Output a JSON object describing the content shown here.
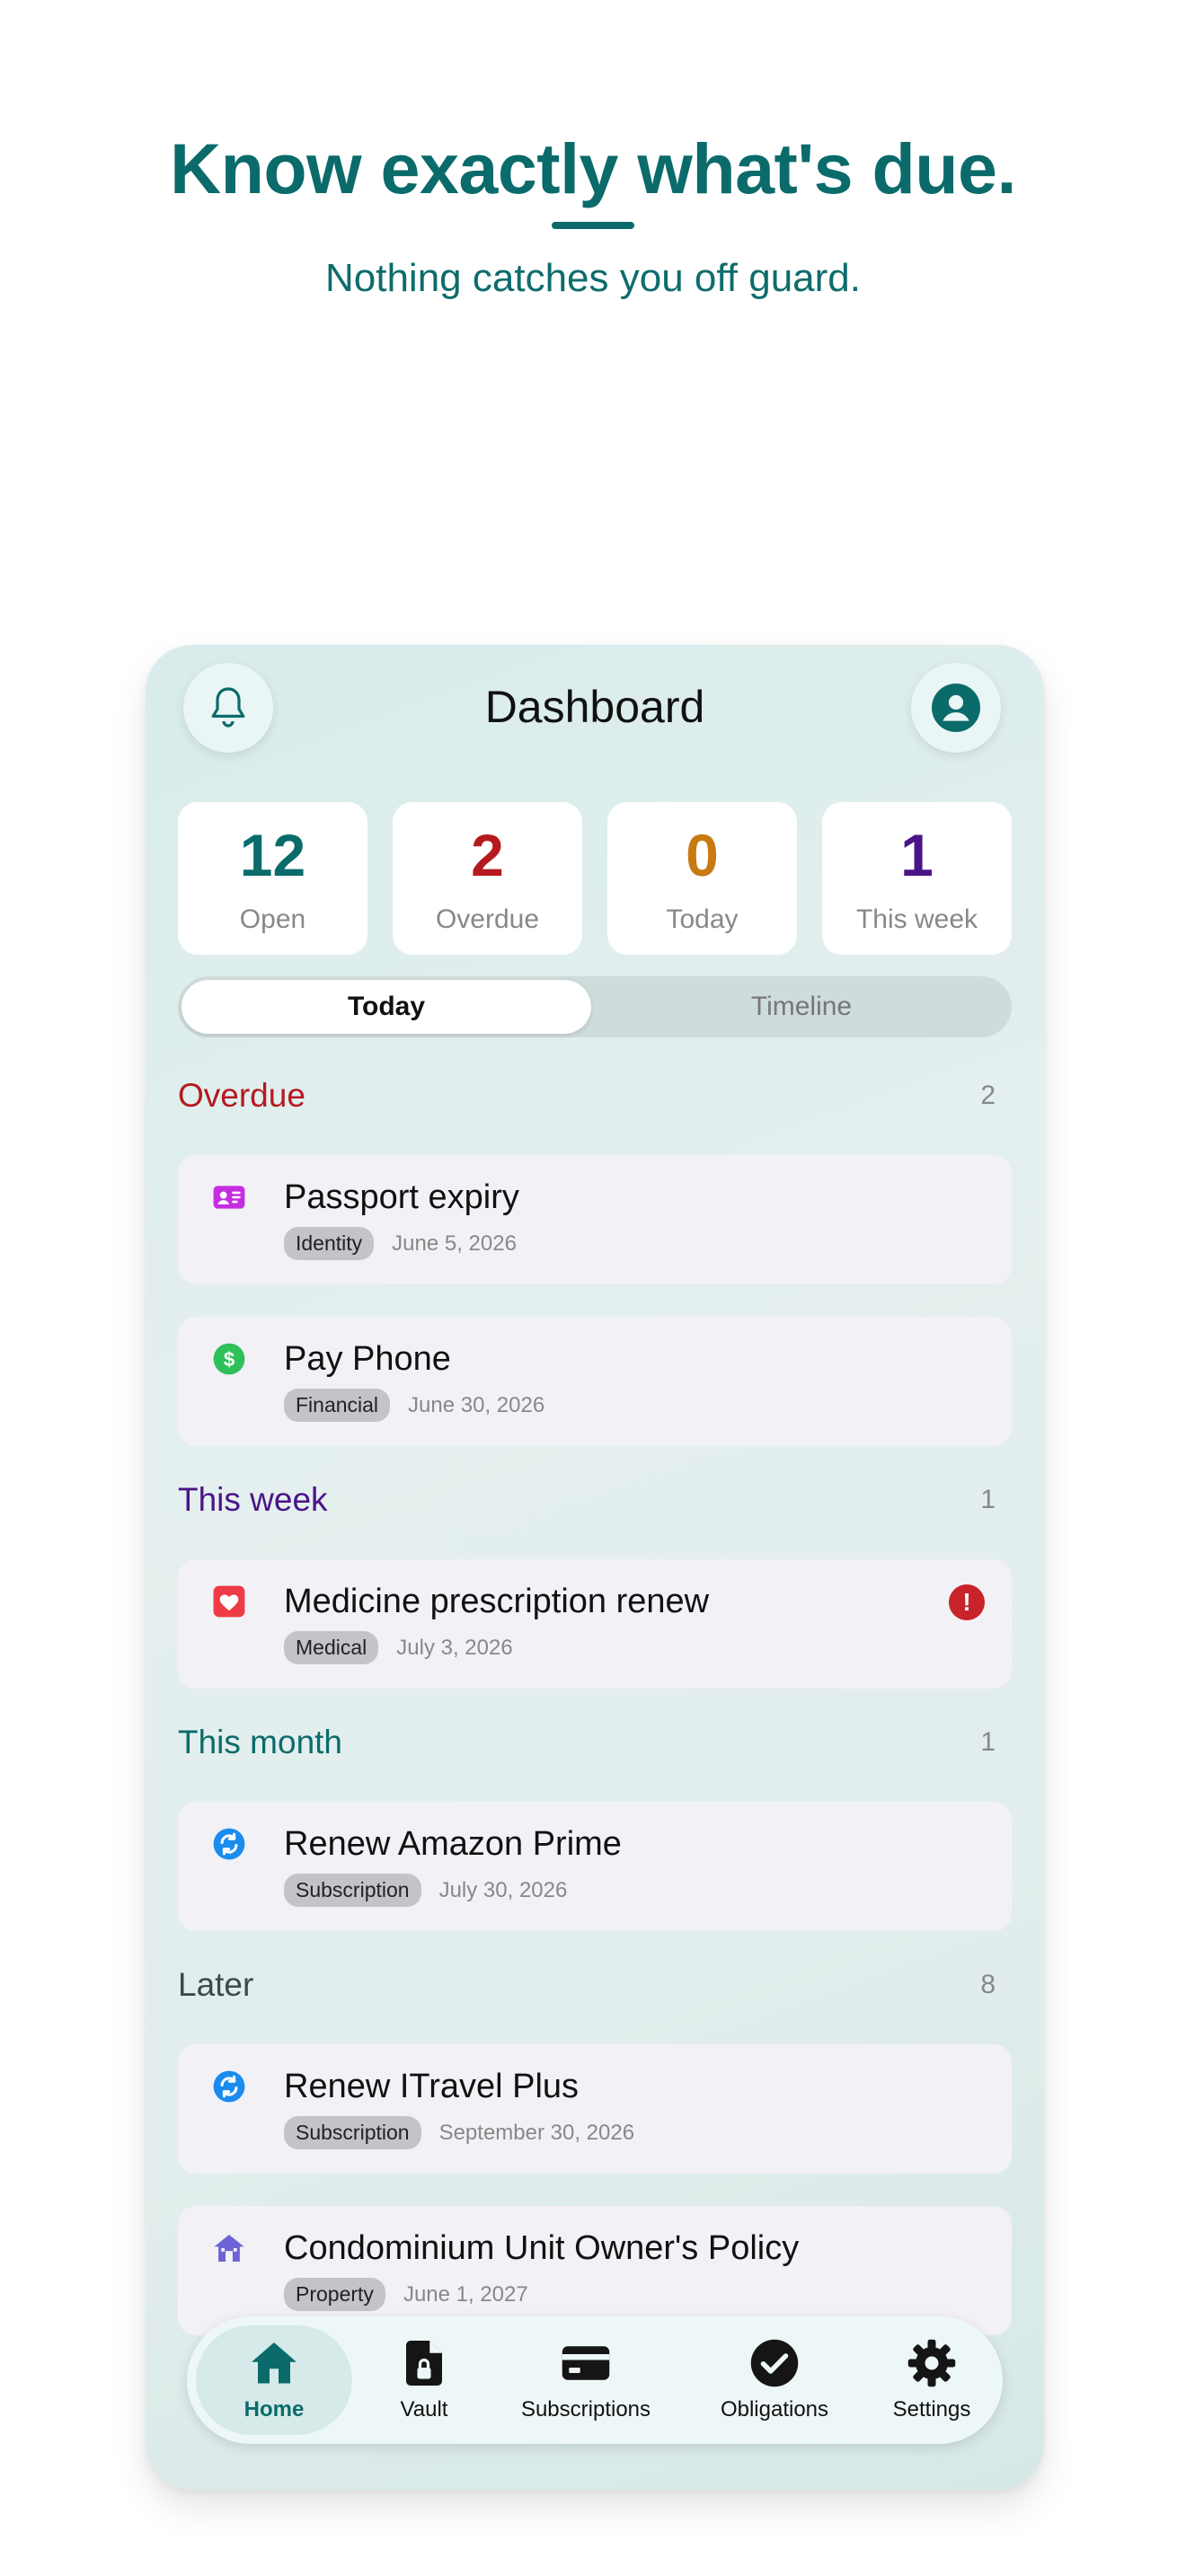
{
  "hero": {
    "title": "Know exactly what's due.",
    "subtitle": "Nothing catches you off guard."
  },
  "header": {
    "title": "Dashboard",
    "left_icon": "bell-icon",
    "right_icon": "profile-icon"
  },
  "stats": [
    {
      "value": "12",
      "label": "Open",
      "color": "#0b6b6b"
    },
    {
      "value": "2",
      "label": "Overdue",
      "color": "#b5191f"
    },
    {
      "value": "0",
      "label": "Today",
      "color": "#c77a12"
    },
    {
      "value": "1",
      "label": "This week",
      "color": "#4a1487"
    }
  ],
  "segments": {
    "active": "Today",
    "inactive": "Timeline"
  },
  "sections": [
    {
      "title": "Overdue",
      "count": "2",
      "color": "#b5191f"
    },
    {
      "title": "This week",
      "count": "1",
      "color": "#4a1487"
    },
    {
      "title": "This month",
      "count": "1",
      "color": "#0b6b6b"
    },
    {
      "title": "Later",
      "count": "8",
      "color": "#3d4a4c"
    }
  ],
  "items": [
    {
      "title": "Passport expiry",
      "tag": "Identity",
      "date": "June 5, 2026",
      "icon": "id-card-icon"
    },
    {
      "title": "Pay Phone",
      "tag": "Financial",
      "date": "June 30, 2026",
      "icon": "dollar-icon"
    },
    {
      "title": "Medicine prescription renew",
      "tag": "Medical",
      "date": "July 3, 2026",
      "icon": "heart-icon",
      "alert": "!"
    },
    {
      "title": "Renew Amazon Prime",
      "tag": "Subscription",
      "date": "July 30, 2026",
      "icon": "renew-icon"
    },
    {
      "title": "Renew ITravel Plus",
      "tag": "Subscription",
      "date": "September 30, 2026",
      "icon": "renew-icon"
    },
    {
      "title": "Condominium Unit Owner's Policy",
      "tag": "Property",
      "date": "June 1, 2027",
      "icon": "house-icon"
    }
  ],
  "nav": [
    {
      "label": "Home",
      "icon": "home-icon",
      "active": true
    },
    {
      "label": "Vault",
      "icon": "document-lock-icon"
    },
    {
      "label": "Subscriptions",
      "icon": "card-icon"
    },
    {
      "label": "Obligations",
      "icon": "check-circle-icon"
    },
    {
      "label": "Settings",
      "icon": "gear-icon"
    }
  ],
  "colors": {
    "brand": "#0b6b6b",
    "overdue": "#b5191f",
    "today": "#c77a12",
    "week": "#4a1487",
    "alert": "#c8232a"
  }
}
